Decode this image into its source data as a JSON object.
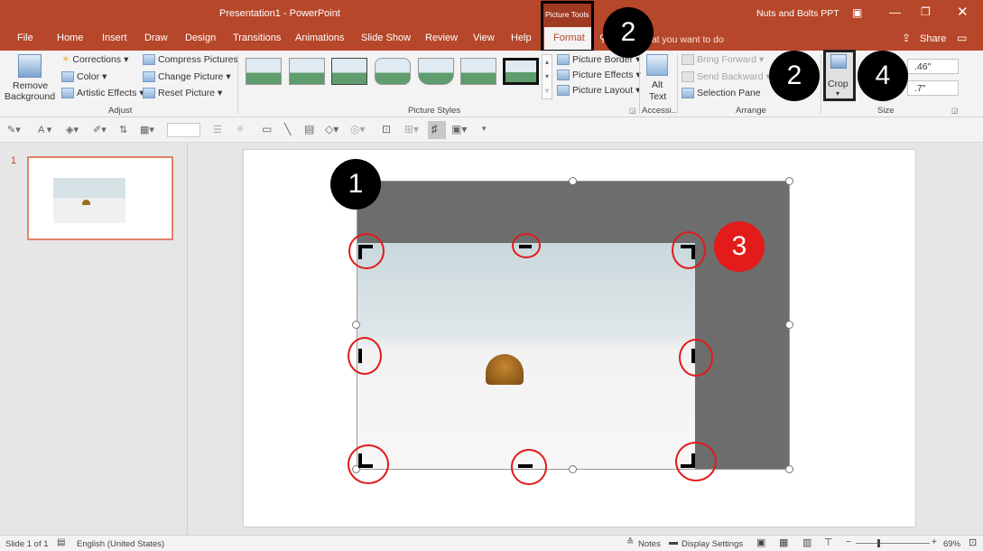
{
  "titlebar": {
    "title": "Presentation1  -  PowerPoint",
    "context_tab_group": "Picture Tools",
    "account": "Nuts and Bolts PPT"
  },
  "tabs": [
    "File",
    "Home",
    "Insert",
    "Draw",
    "Design",
    "Transitions",
    "Animations",
    "Slide Show",
    "Review",
    "View",
    "Help",
    "Format"
  ],
  "tell_me": "hat you want to do",
  "share_label": "Share",
  "ribbon": {
    "remove_background_l1": "Remove",
    "remove_background_l2": "Background",
    "corrections": "Corrections",
    "color": "Color",
    "artistic_effects": "Artistic Effects",
    "compress_pictures": "Compress Pictures",
    "change_picture": "Change Picture",
    "reset_picture": "Reset Picture",
    "group_adjust": "Adjust",
    "group_picture_styles": "Picture Styles",
    "picture_border": "Picture Border",
    "picture_effects": "Picture Effects",
    "picture_layout": "Picture Layout",
    "alt_text_l1": "Alt",
    "alt_text_l2": "Text",
    "group_accessibility": "Accessi...",
    "bring_forward": "Bring Forward",
    "send_backward": "Send Backward",
    "selection_pane": "Selection Pane",
    "group_arrange": "Arrange",
    "crop": "Crop",
    "height_value": ".46\"",
    "width_value": ".7\"",
    "group_size": "Size"
  },
  "thumbnail": {
    "number": "1"
  },
  "callouts": {
    "c1": "1",
    "c2a": "2",
    "c2b": "2",
    "c3": "3",
    "c4": "4"
  },
  "statusbar": {
    "slide_info": "Slide 1 of 1",
    "language": "English (United States)",
    "notes": "Notes",
    "display_settings": "Display Settings",
    "zoom": "69%"
  },
  "colors": {
    "accent": "#b7472a",
    "callout_black": "#000000",
    "callout_red": "#e31b1b",
    "annotation_red": "#e01b1b"
  }
}
